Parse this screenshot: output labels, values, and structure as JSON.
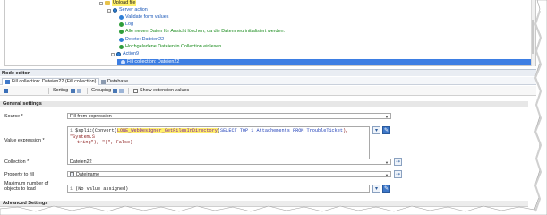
{
  "tree": {
    "upload_file": "Upload file",
    "server_action": "Server action",
    "validate_form": "Validate form values",
    "log": "Log",
    "delete_all_comment": "Alle neuen Daten für Ansicht löschen, da die Daten neu initialisiert werden.",
    "delete_dateien": "Delete: Dateien22",
    "load_files_comment": "Hochgeladene Dateien in Collection einlesen.",
    "action9": "Action9",
    "fill_collection": "Fill collection: Dateien22"
  },
  "editor": {
    "title": "Node editor",
    "tab_main": "Fill collection: Dateien22 (Fill collection)",
    "tab_database": "Database"
  },
  "toolbar": {
    "sorting": "Sorting",
    "grouping": "Grouping",
    "show_extension_values": "Show extension values"
  },
  "props": {
    "general_settings": "General settings",
    "source_label": "Source *",
    "source_value": "Fill from expression",
    "value_expression_label": "Value expression *",
    "expr_line_num": "1",
    "expr_split": "$split(Convert(",
    "expr_fn": "LOWE_WebDesigner_GetFilesInDirectory",
    "expr_mid": "(",
    "expr_select": "SELECT TOP 1 Attachements FROM TroubleTicket",
    "expr_tail": "), \"System.S",
    "expr_line2": "tring\"), \"|\", False)",
    "collection_label": "Collection *",
    "collection_value": "Dateien22",
    "property_label": "Property to fill",
    "property_value": "Dateiname",
    "max_label_1": "Maximum number of",
    "max_label_2": "objects to load",
    "max_line_num": "1",
    "max_value": "(No value assigned)",
    "advanced_settings": "Advanced Settings"
  }
}
